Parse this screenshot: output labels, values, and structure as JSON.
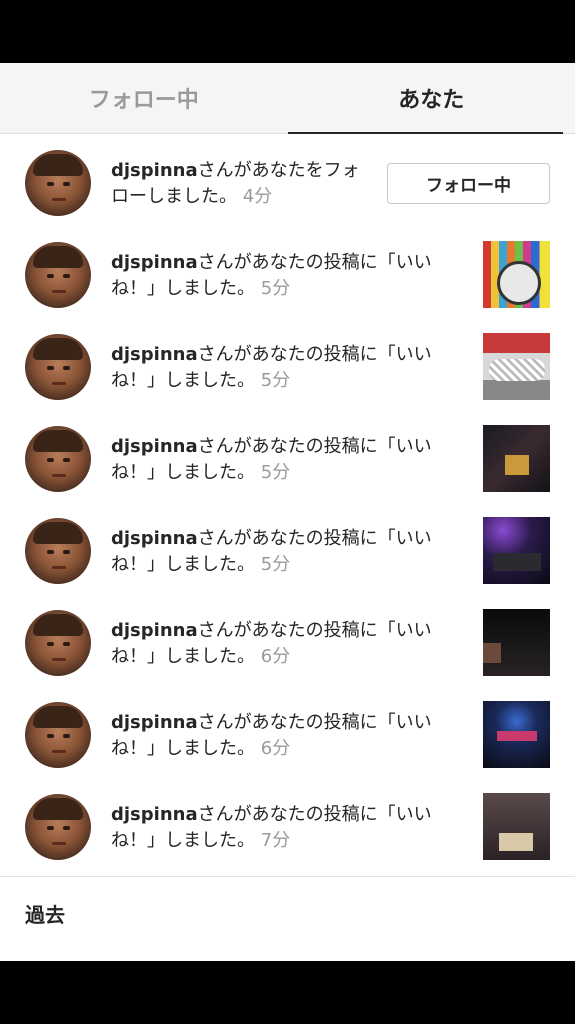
{
  "tabs": [
    {
      "label": "フォロー中",
      "active": false
    },
    {
      "label": "あなた",
      "active": true
    }
  ],
  "notifications": [
    {
      "user": "djspinna",
      "message": "さんがあなたをフォローしました。",
      "time": "4分",
      "action_label": "フォロー中"
    },
    {
      "user": "djspinna",
      "message": "さんがあなたの投稿に「いいね！」しました。",
      "time": "5分"
    },
    {
      "user": "djspinna",
      "message": "さんがあなたの投稿に「いいね！」しました。",
      "time": "5分"
    },
    {
      "user": "djspinna",
      "message": "さんがあなたの投稿に「いいね！」しました。",
      "time": "5分"
    },
    {
      "user": "djspinna",
      "message": "さんがあなたの投稿に「いいね！」しました。",
      "time": "5分"
    },
    {
      "user": "djspinna",
      "message": "さんがあなたの投稿に「いいね！」しました。",
      "time": "6分"
    },
    {
      "user": "djspinna",
      "message": "さんがあなたの投稿に「いいね！」しました。",
      "time": "6分"
    },
    {
      "user": "djspinna",
      "message": "さんがあなたの投稿に「いいね！」しました。",
      "time": "7分"
    }
  ],
  "section": {
    "title": "過去"
  },
  "colors": {
    "text": "#262626",
    "muted": "#9a9a9a",
    "tab_bg": "#f5f5f5"
  }
}
